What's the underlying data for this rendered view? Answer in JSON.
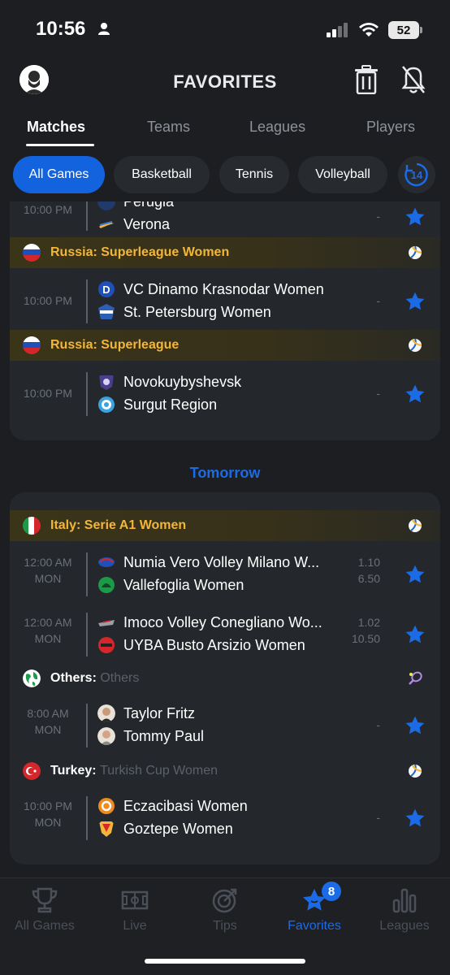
{
  "status_bar": {
    "time": "10:56",
    "battery": "52"
  },
  "header": {
    "title": "FAVORITES"
  },
  "tabs": [
    {
      "label": "Matches",
      "active": true
    },
    {
      "label": "Teams"
    },
    {
      "label": "Leagues"
    },
    {
      "label": "Players"
    }
  ],
  "chips": [
    {
      "label": "All Games",
      "active": true
    },
    {
      "label": "Basketball"
    },
    {
      "label": "Tennis"
    },
    {
      "label": "Volleyball"
    }
  ],
  "calendar_chip": {
    "label": "14"
  },
  "today": {
    "partial_match": {
      "time": "10:00 PM",
      "team1": "Perugia",
      "team2": "Verona",
      "odds": "-"
    },
    "leagues": [
      {
        "country": "Russia",
        "name": "Superleague Women",
        "flag": "russia",
        "sport": "volleyball",
        "matches": [
          {
            "time": "10:00 PM",
            "team1": "VC Dinamo Krasnodar Women",
            "team2": "St. Petersburg Women",
            "odds": "-"
          }
        ]
      },
      {
        "country": "Russia",
        "name": "Superleague",
        "flag": "russia",
        "sport": "volleyball",
        "matches": [
          {
            "time": "10:00 PM",
            "team1": "Novokuybyshevsk",
            "team2": "Surgut Region",
            "odds": "-"
          }
        ]
      }
    ]
  },
  "tomorrow": {
    "label": "Tomorrow",
    "leagues": [
      {
        "country": "Italy",
        "name": "Serie A1 Women",
        "flag": "italy",
        "sport": "volleyball",
        "matches": [
          {
            "time": "12:00 AM",
            "day": "MON",
            "team1": "Numia Vero Volley Milano W...",
            "team2": "Vallefoglia Women",
            "odds1": "1.10",
            "odds2": "6.50"
          },
          {
            "time": "12:00 AM",
            "day": "MON",
            "team1": "Imoco Volley Conegliano Wo...",
            "team2": "UYBA Busto Arsizio Women",
            "odds1": "1.02",
            "odds2": "10.50"
          }
        ]
      },
      {
        "country": "Others",
        "name": "Others",
        "flag": "globe",
        "sport": "tennis",
        "matches": [
          {
            "time": "8:00 AM",
            "day": "MON",
            "team1": "Taylor Fritz",
            "team2": "Tommy Paul",
            "odds": "-"
          }
        ]
      },
      {
        "country": "Turkey",
        "name": "Turkish Cup Women",
        "flag": "turkey",
        "sport": "volleyball",
        "matches": [
          {
            "time": "10:00 PM",
            "day": "MON",
            "team1": "Eczacibasi Women",
            "team2": "Goztepe Women",
            "odds": "-"
          }
        ]
      }
    ]
  },
  "bottom_nav": {
    "items": [
      {
        "label": "All Games",
        "icon": "trophy-icon"
      },
      {
        "label": "Live",
        "icon": "field-icon"
      },
      {
        "label": "Tips",
        "icon": "tips-icon"
      },
      {
        "label": "Favorites",
        "icon": "star-icon",
        "active": true,
        "badge": "8"
      },
      {
        "label": "Leagues",
        "icon": "bars-icon"
      }
    ]
  },
  "colors": {
    "accent": "#1c6be6",
    "league_gold": "#f2b63a",
    "card_bg": "#24272c",
    "page_bg": "#1c1e22"
  }
}
